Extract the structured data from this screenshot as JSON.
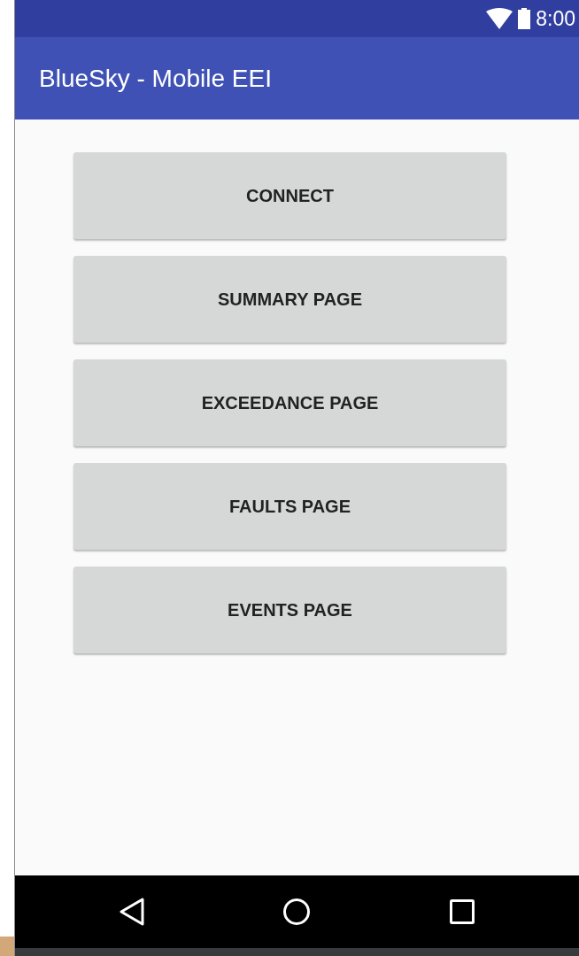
{
  "status_bar": {
    "time": "8:00"
  },
  "app_bar": {
    "title": "BlueSky - Mobile EEI"
  },
  "buttons": [
    "CONNECT",
    "SUMMARY PAGE",
    "EXCEEDANCE PAGE",
    "FAULTS PAGE",
    "EVENTS PAGE"
  ]
}
